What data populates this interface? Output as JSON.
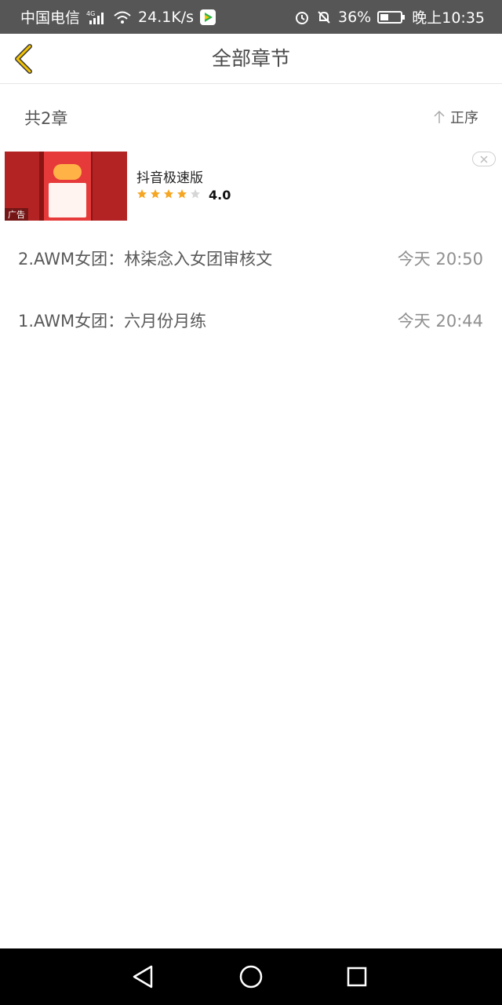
{
  "status_bar": {
    "carrier": "中国电信",
    "network": "4G",
    "speed": "24.1K/s",
    "battery": "36%",
    "time": "晚上10:35",
    "icons": [
      "signal-icon",
      "wifi-icon",
      "video-app-icon",
      "alarm-icon",
      "bell-muted-icon",
      "battery-icon"
    ]
  },
  "header": {
    "title": "全部章节",
    "back_icon": "chevron-left-icon",
    "accent_color": "#f5c400"
  },
  "chapter_list": {
    "count_label": "共2章",
    "sort_label": "正序",
    "sort_icon": "arrow-up-icon"
  },
  "ad": {
    "tag": "广告",
    "app_name": "抖音极速版",
    "stars_filled": 4,
    "stars_total": 5,
    "rating": "4.0",
    "close_icon": "close-icon",
    "star_color": "#f5a623"
  },
  "chapters": [
    {
      "title": "2.AWM女团：林柒念入女团审核文",
      "time": "今天 20:50"
    },
    {
      "title": "1.AWM女团：六月份月练",
      "time": "今天 20:44"
    }
  ],
  "nav_bar": {
    "icons": [
      "back-triangle-icon",
      "home-circle-icon",
      "recents-square-icon"
    ]
  }
}
